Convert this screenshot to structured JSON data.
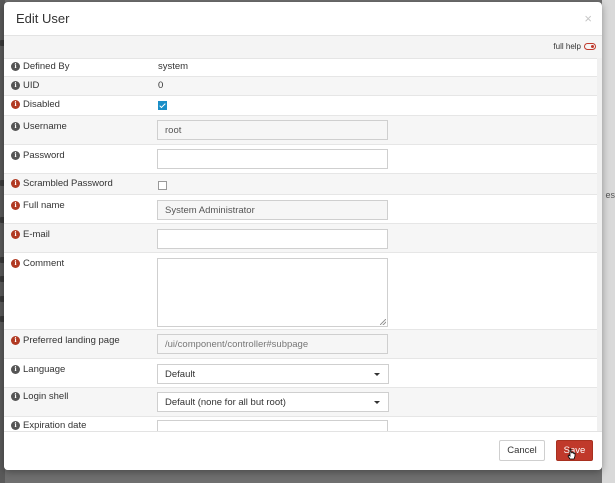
{
  "dialog": {
    "title": "Edit User",
    "close_glyph": "×",
    "help_label": "full help"
  },
  "fields": {
    "defined_by": {
      "label": "Defined By",
      "value": "system"
    },
    "uid": {
      "label": "UID",
      "value": "0"
    },
    "disabled": {
      "label": "Disabled",
      "checked": true
    },
    "username": {
      "label": "Username",
      "value": "root"
    },
    "password": {
      "label": "Password",
      "value": ""
    },
    "scrambled_password": {
      "label": "Scrambled Password",
      "checked": false
    },
    "full_name": {
      "label": "Full name",
      "value": "System Administrator"
    },
    "email": {
      "label": "E-mail",
      "value": ""
    },
    "comment": {
      "label": "Comment",
      "value": ""
    },
    "landing_page": {
      "label": "Preferred landing page",
      "placeholder": "/ui/component/controller#subpage"
    },
    "language": {
      "label": "Language",
      "value": "Default"
    },
    "login_shell": {
      "label": "Login shell",
      "value": "Default (none for all but root)"
    },
    "expiration_date": {
      "label": "Expiration date",
      "value": ""
    }
  },
  "footer": {
    "cancel_label": "Cancel",
    "save_label": "Save"
  },
  "background": {
    "right_edge_text": "es"
  },
  "colors": {
    "accent": "#c0392b",
    "checkbox": "#1a8ec7"
  }
}
